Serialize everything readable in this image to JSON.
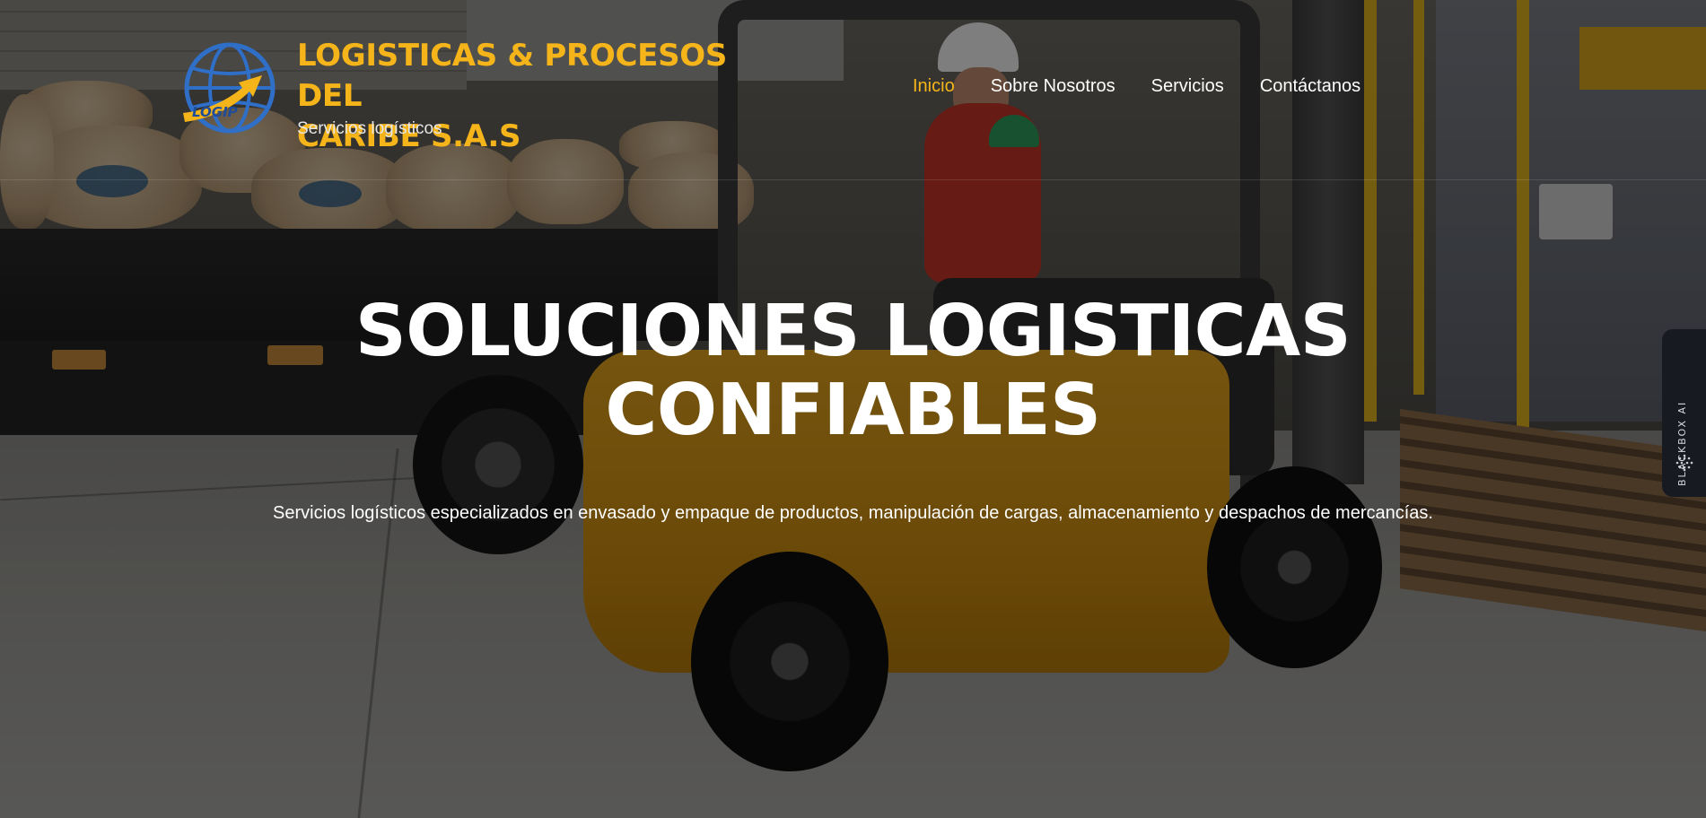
{
  "brand": {
    "title_line1": "LOGISTICAS & PROCESOS DEL",
    "title_line2": "CARIBE S.A.S",
    "tagline": "Servicios logísticos",
    "logo_text": "LOGIP",
    "accent_color": "#f5b51a",
    "logo_globe_color": "#2f6fc8"
  },
  "nav": {
    "items": [
      {
        "label": "Inicio",
        "active": true
      },
      {
        "label": "Sobre Nosotros",
        "active": false
      },
      {
        "label": "Servicios",
        "active": false
      },
      {
        "label": "Contáctanos",
        "active": false
      }
    ]
  },
  "hero": {
    "title_line1": "SOLUCIONES LOGISTICAS",
    "title_line2": "CONFIABLES",
    "subtitle": "Servicios logísticos especializados en envasado y empaque de productos, manipulación de cargas, almacenamiento y despachos de mercancías."
  },
  "side_widget": {
    "label": "BLACKBOX AI",
    "icon": "dots-grid-icon"
  }
}
